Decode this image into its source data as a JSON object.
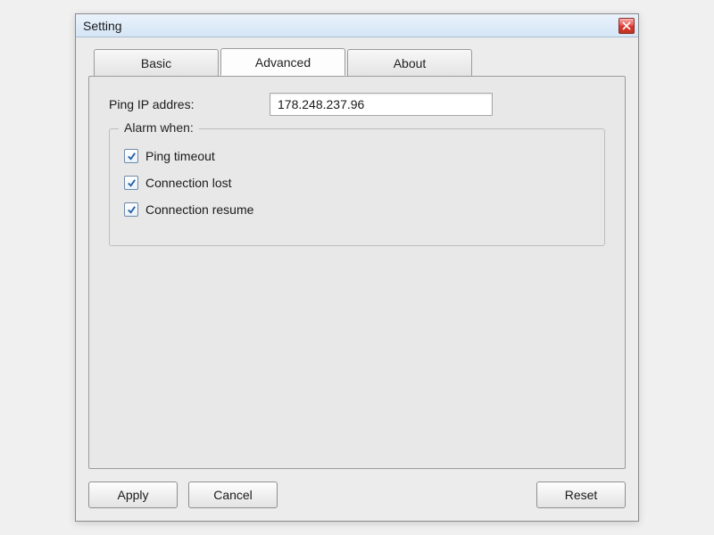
{
  "window": {
    "title": "Setting"
  },
  "tabs": {
    "basic": "Basic",
    "advanced": "Advanced",
    "about": "About",
    "active": "advanced"
  },
  "ping": {
    "label": "Ping IP addres:",
    "value": "178.248.237.96"
  },
  "alarm": {
    "legend": "Alarm when:",
    "items": [
      {
        "label": "Ping timeout",
        "checked": true
      },
      {
        "label": "Connection lost",
        "checked": true
      },
      {
        "label": "Connection resume",
        "checked": true
      }
    ]
  },
  "buttons": {
    "apply": "Apply",
    "cancel": "Cancel",
    "reset": "Reset"
  }
}
